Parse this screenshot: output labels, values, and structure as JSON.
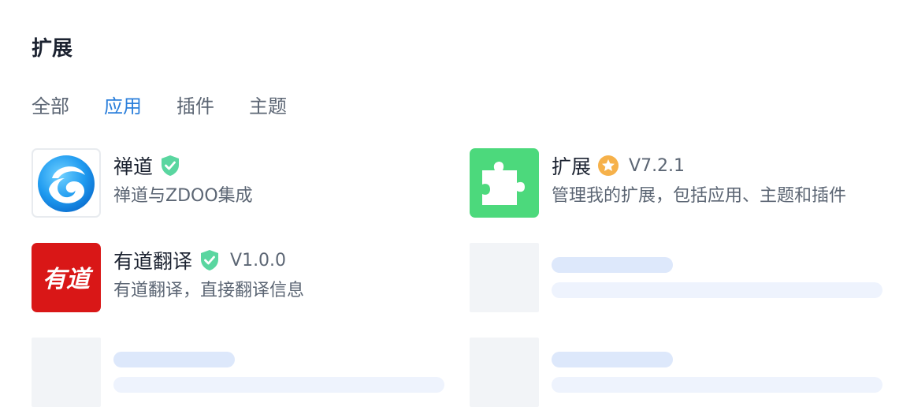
{
  "header": {
    "title": "扩展"
  },
  "tabs": [
    {
      "label": "全部",
      "active": false
    },
    {
      "label": "应用",
      "active": true
    },
    {
      "label": "插件",
      "active": false
    },
    {
      "label": "主题",
      "active": false
    }
  ],
  "extensions": [
    {
      "name": "禅道",
      "badge": "verified-shield-icon",
      "version": "",
      "description": "禅道与ZDOO集成",
      "icon": "zentao-logo-icon"
    },
    {
      "name": "扩展",
      "badge": "official-star-icon",
      "version": "V7.2.1",
      "description": "管理我的扩展，包括应用、主题和插件",
      "icon": "puzzle-piece-icon"
    },
    {
      "name": "有道翻译",
      "badge": "verified-shield-icon",
      "version": "V1.0.0",
      "description": "有道翻译，直接翻译信息",
      "icon": "youdao-logo-icon",
      "logo_text": "有道"
    }
  ],
  "colors": {
    "accent": "#2b7fdb",
    "verified_badge": "#5ad6a0",
    "official_badge": "#f6b14a",
    "puzzle_bg": "#4cd97c",
    "youdao_bg": "#d91717",
    "skeleton": "#f2f4f7"
  }
}
